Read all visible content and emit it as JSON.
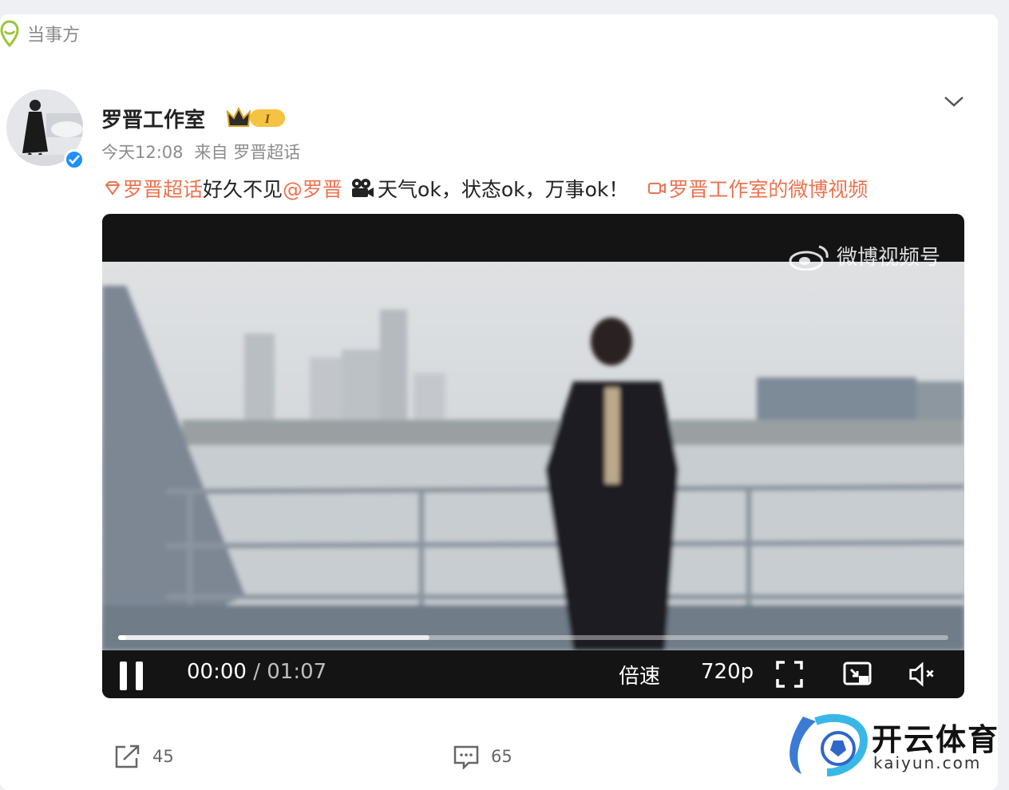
{
  "label": "当事方",
  "author": {
    "name": "罗晋工作室",
    "level_badge": "I",
    "time": "今天12:08",
    "source_prefix": "来自",
    "source": "罗晋超话"
  },
  "post": {
    "topic": "罗晋超话",
    "text1": " 好久不见",
    "mention": "@罗晋",
    "text2": "天气ok，状态ok，万事ok！",
    "video_link": "罗晋工作室的微博视频"
  },
  "player": {
    "watermark": "微博视频号",
    "current_time": "00:00",
    "separator": " / ",
    "total_time": "01:07",
    "speed_label": "倍速",
    "quality_label": "720p",
    "progress_played": 0.01,
    "progress_buffered": 0.375
  },
  "actions": {
    "repost_count": "45",
    "comment_count": "65"
  },
  "site": {
    "logo_text": "开云体育",
    "url": "kaiyun.com"
  },
  "colors": {
    "link": "#eb7350",
    "verified": "#1e90ff"
  }
}
